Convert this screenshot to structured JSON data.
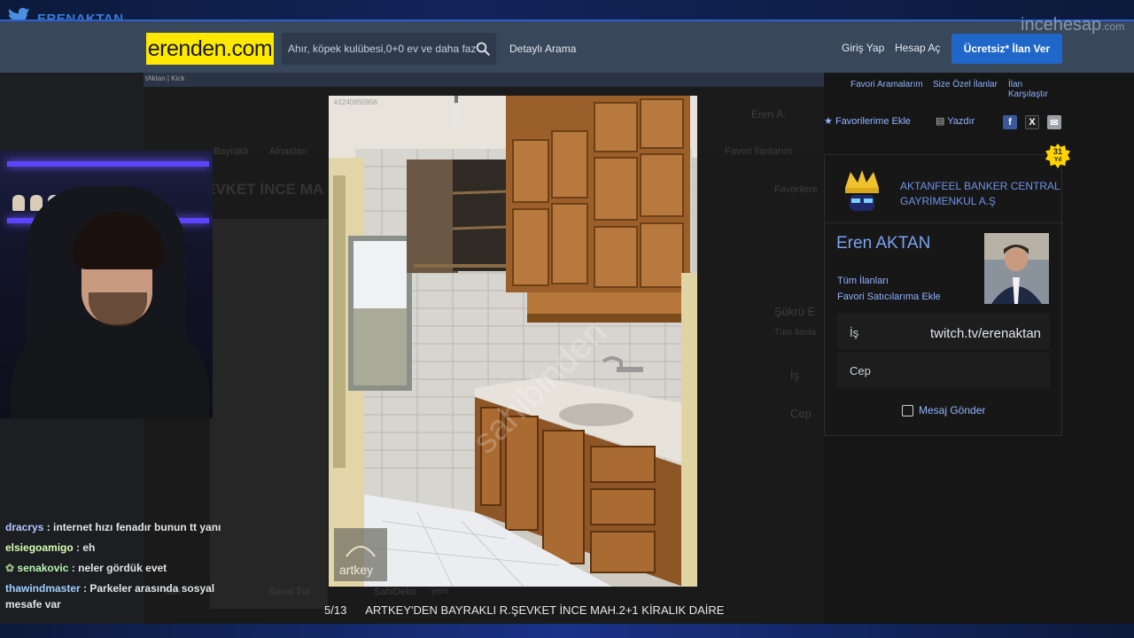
{
  "stream": {
    "channel_name": "ERENAKTAN",
    "chat": [
      {
        "user": "dracrys",
        "text": "internet hızı fenadır bunun tt yanı",
        "color": "#b8c8ff"
      },
      {
        "user": "elsiegoamigo",
        "text": "eh",
        "color": "#d7ffb0"
      },
      {
        "user": "senakovic",
        "text": "neler gördük evet",
        "color": "#b7f5b2"
      },
      {
        "user": "thawindmaster",
        "text": "Parkeler arasında sosyal mesafe var",
        "color": "#9fd0ff"
      }
    ]
  },
  "site": {
    "logo": "erenden.com",
    "search_placeholder": "Ahır, köpek kulübesi,0+0 ev ve daha fazlası",
    "detailed_search": "Detaylı Arama",
    "login": "Giriş Yap",
    "signup": "Hesap Aç",
    "post_ad": "Ücretsiz* İlan Ver",
    "watermark_main": "incehesap",
    "watermark_suffix": ".com",
    "crumb": "tAktan | Kick"
  },
  "listing": {
    "dim_title": "EVKET İNCE MA",
    "dim_breadcrumb_1": "Bayraklı",
    "dim_breadcrumb_2": "Alnasları",
    "dim_user": "Eren A.",
    "dim_fav": "Favori İlanlarım",
    "dim_fav_add": "Favorilere",
    "dim_seller": "Şükrü E",
    "dim_all_ads": "Tüm İlanla",
    "dim_is": "İş",
    "dim_cep": "Cep",
    "dim_tab_1": "İlan",
    "dim_tab_2": "Sanal Tur",
    "dim_tab_3": "SahiDeko",
    "dim_tab_3_suffix": "yeni",
    "photo_id": "#1240650956",
    "photo_watermark": "sahibinden",
    "artkey_label": "artkey"
  },
  "lightbox": {
    "counter": "5/13",
    "title": "ARTKEY'DEN BAYRAKLI R.ŞEVKET İNCE MAH.2+1 KİRALIK DAİRE"
  },
  "side": {
    "links": [
      "Favori Aramalarım",
      "Size Özel İlanlar",
      "İlan Karşılaştır"
    ],
    "add_fav": "Favorilerime Ekle",
    "print": "Yazdır",
    "badge_number": "31",
    "badge_unit": "Yıl",
    "company": "AKTANFEEL BANKER CENTRAL GAYRİMENKUL A.Ş",
    "seller_name": "Eren AKTAN",
    "all_ads": "Tüm İlanları",
    "fav_seller": "Favori Satıcılarıma Ekle",
    "work_label": "İş",
    "work_value": "twitch.tv/erenaktan",
    "mobile_label": "Cep",
    "send_message": "Mesaj Gönder"
  },
  "colors": {
    "header_bg": "#39475b",
    "logo_bg": "#ffe800",
    "accent_blue": "#1f67c9",
    "link_blue": "#8fb4ff"
  }
}
